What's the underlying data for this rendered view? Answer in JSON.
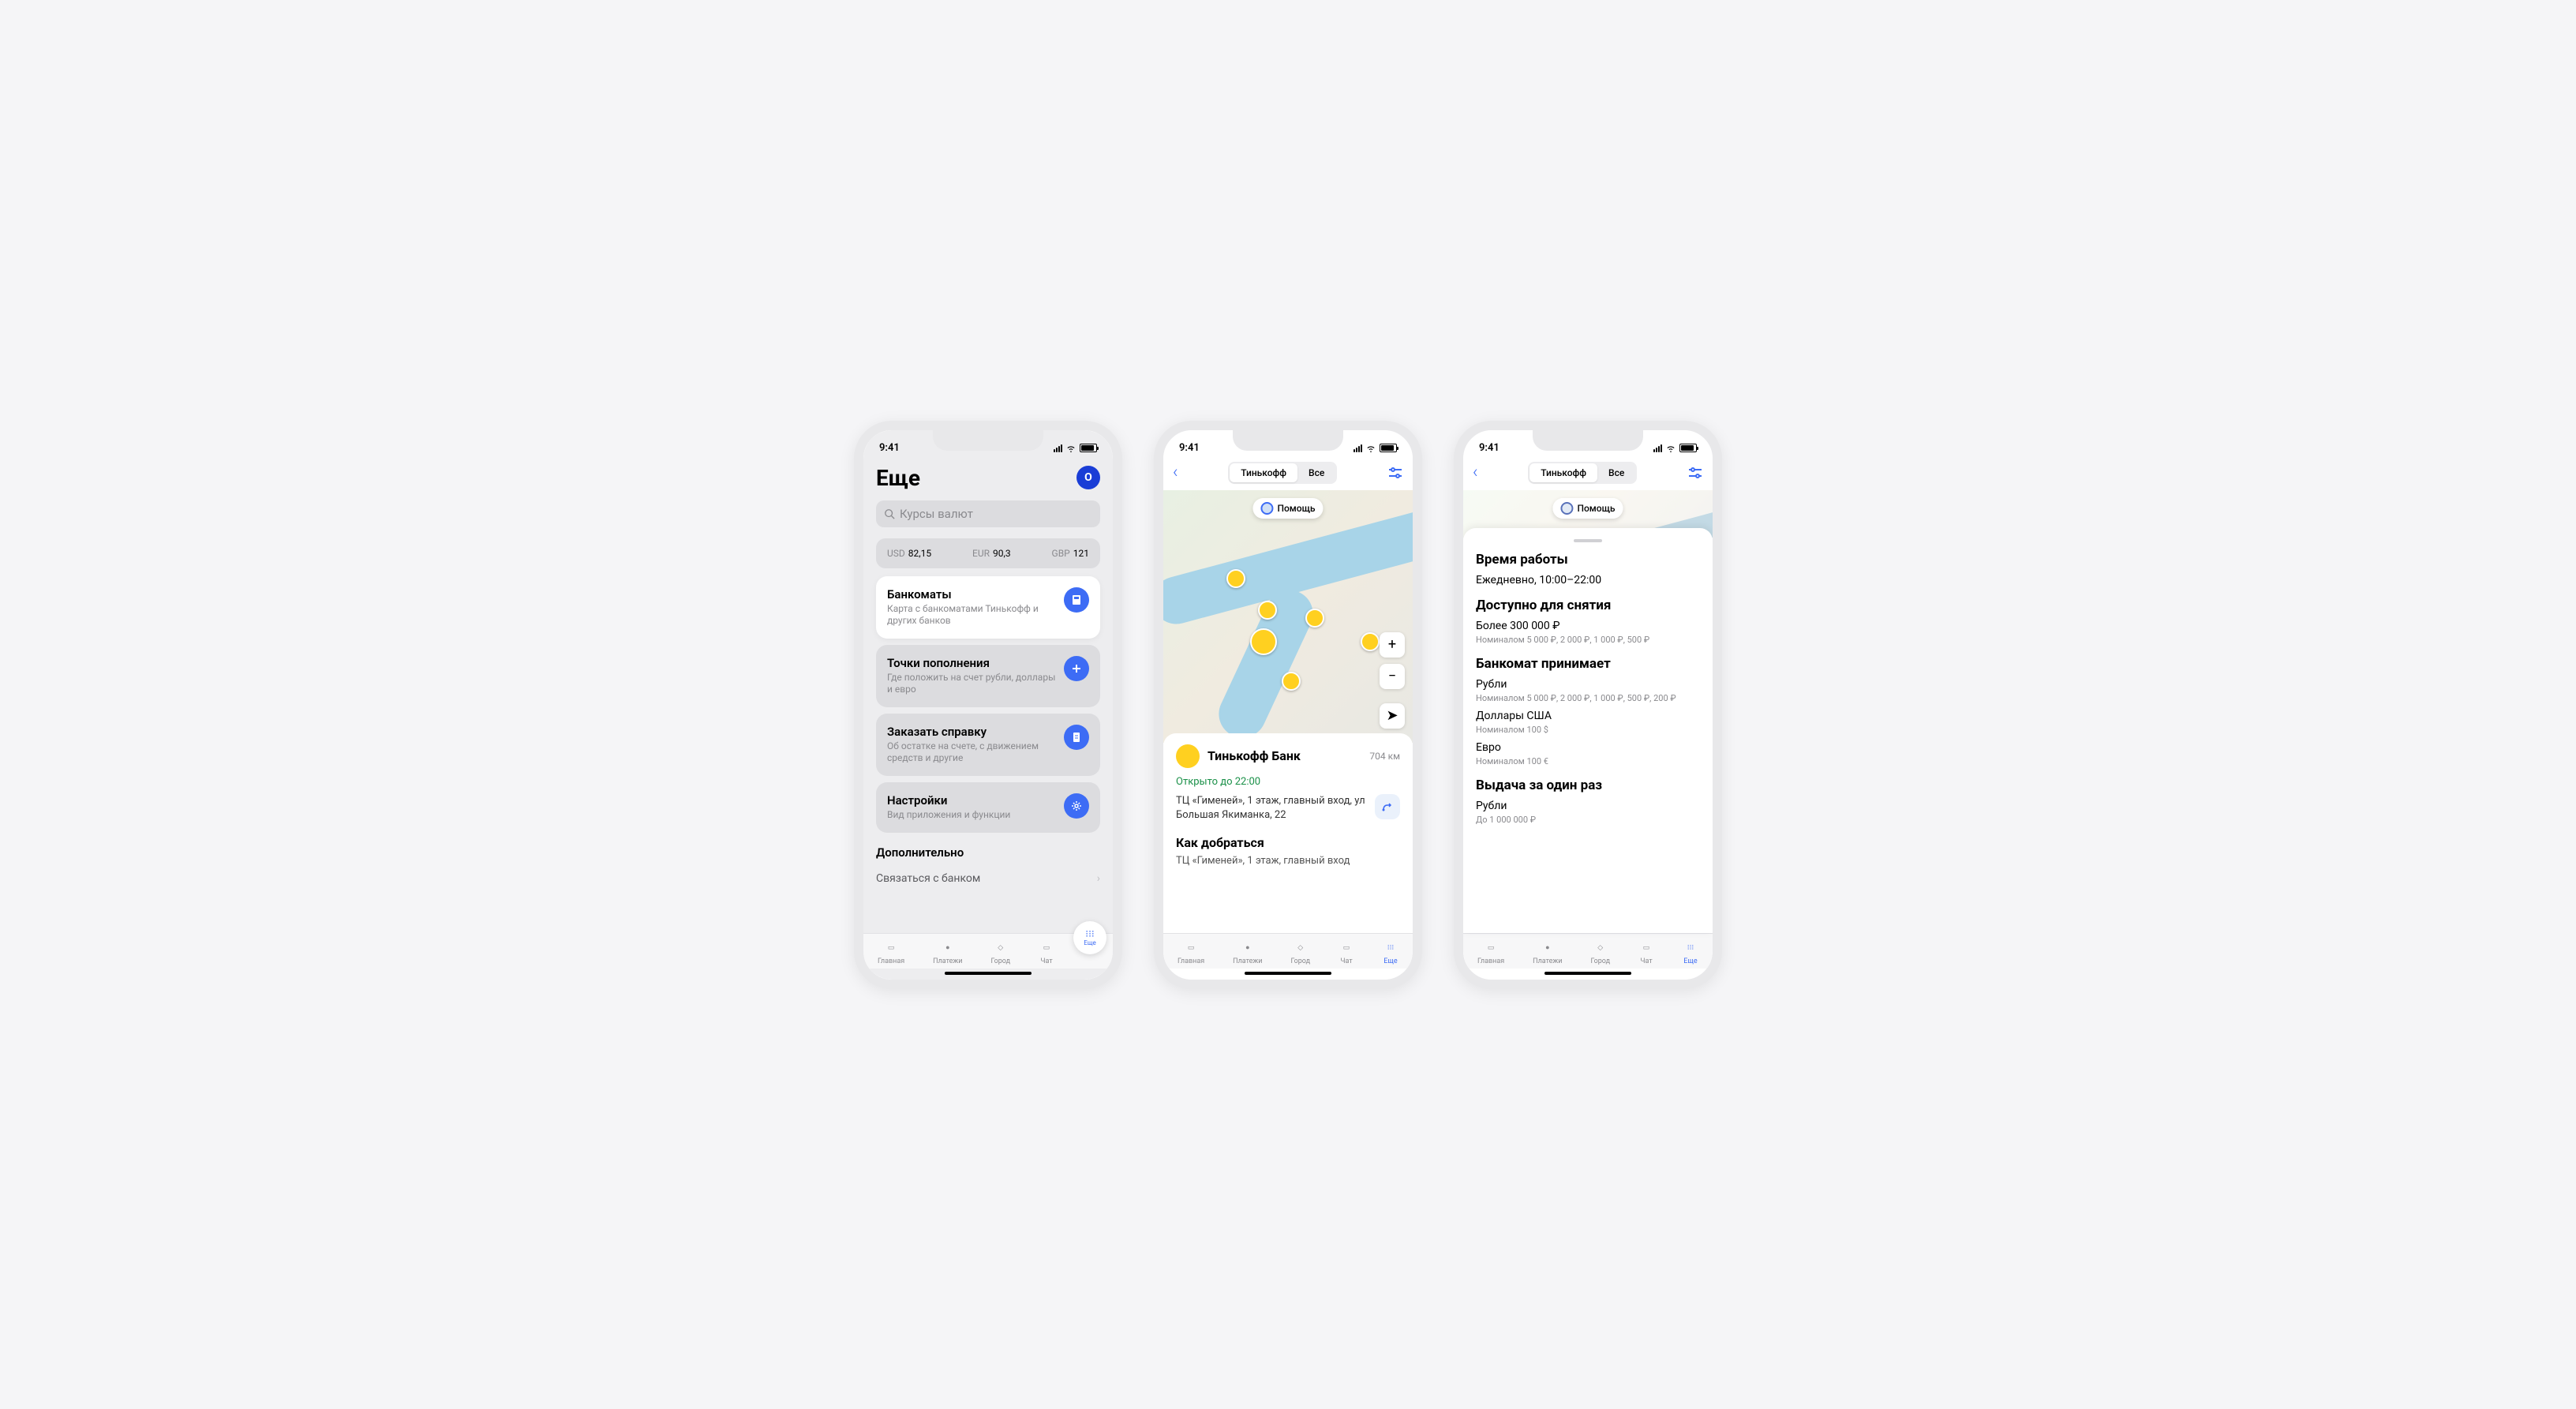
{
  "status": {
    "time": "9:41"
  },
  "p1": {
    "title": "Еще",
    "avatar": "О",
    "search_placeholder": "Курсы валют",
    "rates": [
      {
        "label": "USD",
        "value": "82,15"
      },
      {
        "label": "EUR",
        "value": "90,3"
      },
      {
        "label": "GBP",
        "value": "121"
      }
    ],
    "cards": [
      {
        "title": "Банкоматы",
        "sub": "Карта с банкоматами Тинькофф и других банков",
        "white": true
      },
      {
        "title": "Точки пополнения",
        "sub": "Где положить на счет рубли, доллары и евро",
        "white": false
      },
      {
        "title": "Заказать справку",
        "sub": "Об остатке на счете, с движением средств и другие",
        "white": false
      },
      {
        "title": "Настройки",
        "sub": "Вид приложения и функции",
        "white": false
      }
    ],
    "extra_title": "Дополнительно",
    "extra_link": "Связаться с банком"
  },
  "p2": {
    "seg": [
      "Тинькофф",
      "Все"
    ],
    "help": "Помощь",
    "bank_name": "Тинькофф Банк",
    "distance": "704 км",
    "open_status": "Открыто до 22:00",
    "address": "ТЦ «Гименей», 1 этаж, главный вход, ул Большая Якиманка, 22",
    "directions_title": "Как добраться",
    "directions_text": "ТЦ «Гименей», 1 этаж, главный вход"
  },
  "p3": {
    "hours_title": "Время работы",
    "hours": "Ежедневно, 10:00–22:00",
    "withdraw_title": "Доступно для снятия",
    "withdraw_amt": "Более 300 000 ₽",
    "withdraw_denom": "Номиналом 5 000 ₽, 2 000 ₽, 1 000 ₽, 500 ₽",
    "accepts_title": "Банкомат принимает",
    "accepts": [
      {
        "name": "Рубли",
        "denom": "Номиналом 5 000 ₽, 2 000 ₽, 1 000 ₽, 500 ₽, 200 ₽"
      },
      {
        "name": "Доллары США",
        "denom": "Номиналом 100 $"
      },
      {
        "name": "Евро",
        "denom": "Номиналом 100 €"
      }
    ],
    "dispense_title": "Выдача за один раз",
    "dispense_name": "Рубли",
    "dispense_denom": "До 1 000 000 ₽"
  },
  "tabs": [
    {
      "label": "Главная"
    },
    {
      "label": "Платежи"
    },
    {
      "label": "Город"
    },
    {
      "label": "Чат"
    },
    {
      "label": "Еще"
    }
  ]
}
